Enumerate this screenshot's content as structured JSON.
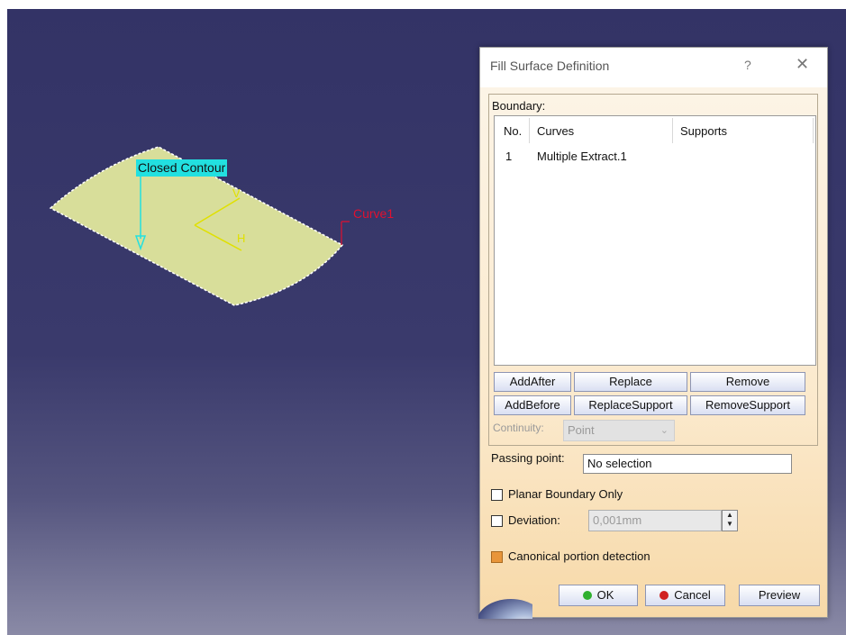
{
  "viewport": {
    "label_closed_contour": "Closed Contour",
    "label_curve": "Curve1",
    "axis_v": "V",
    "axis_h": "H",
    "colors": {
      "surface": "#d8de9a",
      "contour_tag": "#22e0e0",
      "curve_label": "#e01030",
      "axis": "#e0e000"
    }
  },
  "dialog": {
    "title": "Fill Surface Definition",
    "help_glyph": "?",
    "close_glyph": "✕",
    "boundary": {
      "group_label": "Boundary:",
      "columns": [
        "No.",
        "Curves",
        "Supports"
      ],
      "rows": [
        {
          "no": "1",
          "curve": "Multiple Extract.1",
          "support": ""
        }
      ]
    },
    "buttons": {
      "add_after": "AddAfter",
      "replace": "Replace",
      "remove": "Remove",
      "add_before": "AddBefore",
      "replace_support": "ReplaceSupport",
      "remove_support": "RemoveSupport"
    },
    "continuity": {
      "label": "Continuity:",
      "value": "Point"
    },
    "passing_point": {
      "label": "Passing point:",
      "value": "No selection"
    },
    "planar_boundary_only": {
      "label": "Planar Boundary Only",
      "checked": false
    },
    "deviation": {
      "label": "Deviation:",
      "value": "0,001mm",
      "checked": false
    },
    "canonical_detection": {
      "label": "Canonical portion detection",
      "checked": true
    },
    "footer": {
      "ok": "OK",
      "cancel": "Cancel",
      "preview": "Preview"
    }
  }
}
